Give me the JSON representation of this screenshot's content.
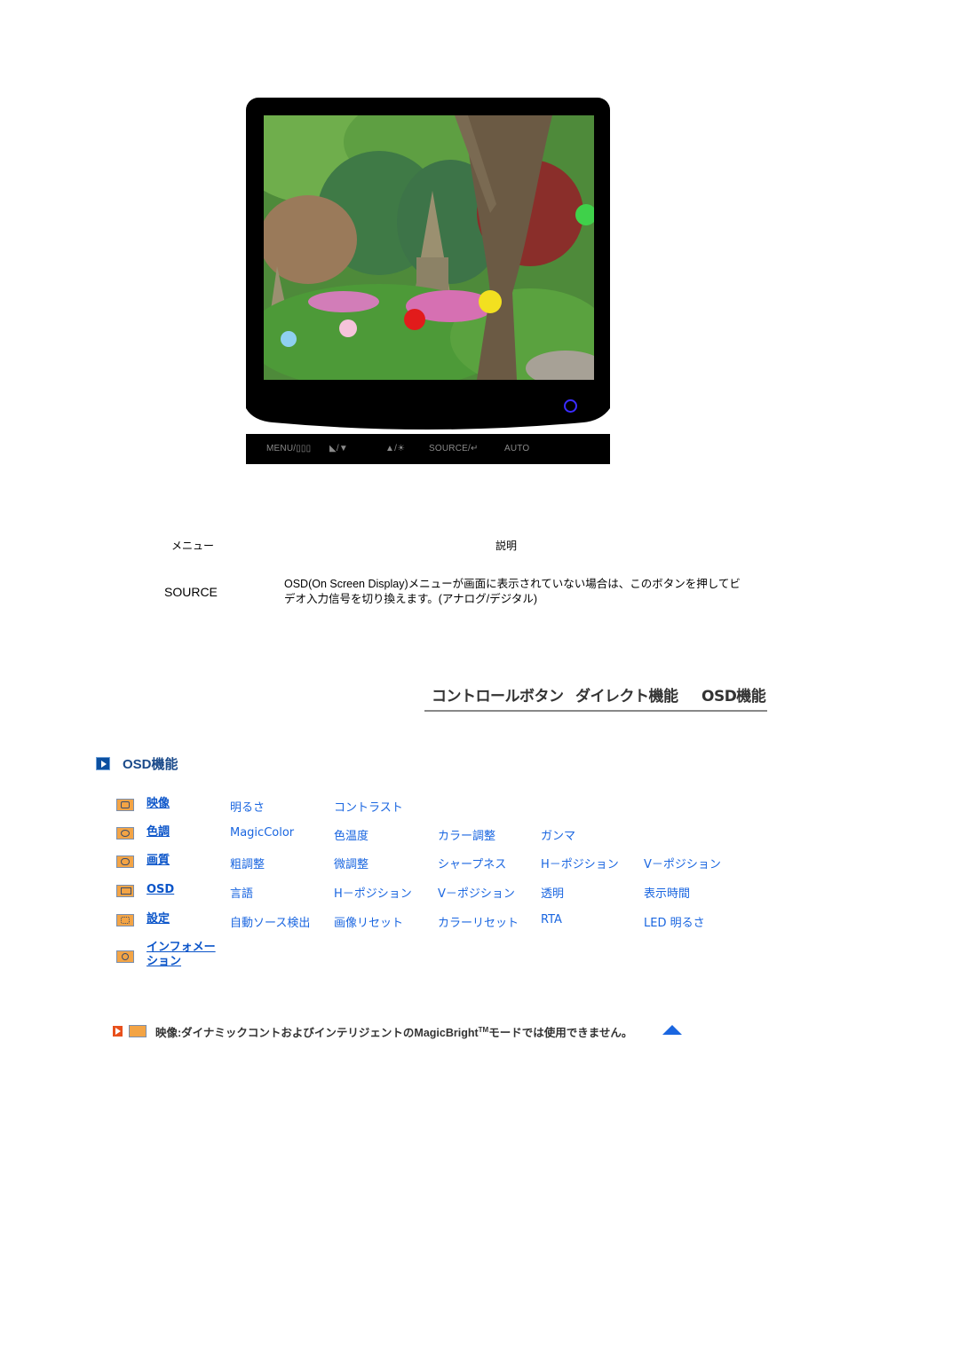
{
  "monitor": {
    "image_alt": "Garden with stone pagoda and lanterns",
    "buttons": [
      "MENU/▯▯▯",
      "◣/▼",
      "▲/☀",
      "SOURCE/↵",
      "AUTO"
    ],
    "power_led_color": "#3a2cff"
  },
  "table": {
    "header_menu": "メニュー",
    "header_description": "説明",
    "rows": [
      {
        "menu": "SOURCE",
        "description": "OSD(On Screen Display)メニューが画面に表示されていない場合は、このボタンを押してビデオ入力信号を切り換えます。(アナログ/デジタル)"
      }
    ]
  },
  "nav": {
    "items": [
      "コントロールボタン",
      "ダイレクト機能",
      "OSD機能"
    ]
  },
  "section": {
    "title": "OSD機能",
    "accent": "#0b4fa0"
  },
  "osd": {
    "rows": [
      {
        "category": "映像",
        "icon": "picture-icon",
        "items": [
          "明るさ",
          "コントラスト"
        ]
      },
      {
        "category": "色調",
        "icon": "color-tone-icon",
        "items": [
          "MagicColor",
          "色温度",
          "カラー調整",
          "ガンマ"
        ]
      },
      {
        "category": "画質",
        "icon": "image-quality-icon",
        "items": [
          "粗調整",
          "微調整",
          "シャープネス",
          "H－ポジション",
          "V－ポジション"
        ]
      },
      {
        "category": "OSD",
        "icon": "osd-icon",
        "items": [
          "言語",
          "H－ポジション",
          "V－ポジション",
          "透明",
          "表示時間"
        ]
      },
      {
        "category": "設定",
        "icon": "setup-icon",
        "items": [
          "自動ソース検出",
          "画像リセット",
          "カラーリセット",
          "RTA",
          "LED 明るさ"
        ]
      },
      {
        "category": "インフォメーション",
        "category_line1": "インフォメー",
        "category_line2": "ション",
        "icon": "information-icon",
        "items": []
      }
    ]
  },
  "note": {
    "text_before": "映像:ダイナミックコントおよびインテリジェントのMagicBright",
    "tm": "TM",
    "text_after": "モードでは使用できません。"
  },
  "colors": {
    "link": "#1a66e0",
    "category": "#0b55c9",
    "icon_bg": "#f3a445"
  }
}
